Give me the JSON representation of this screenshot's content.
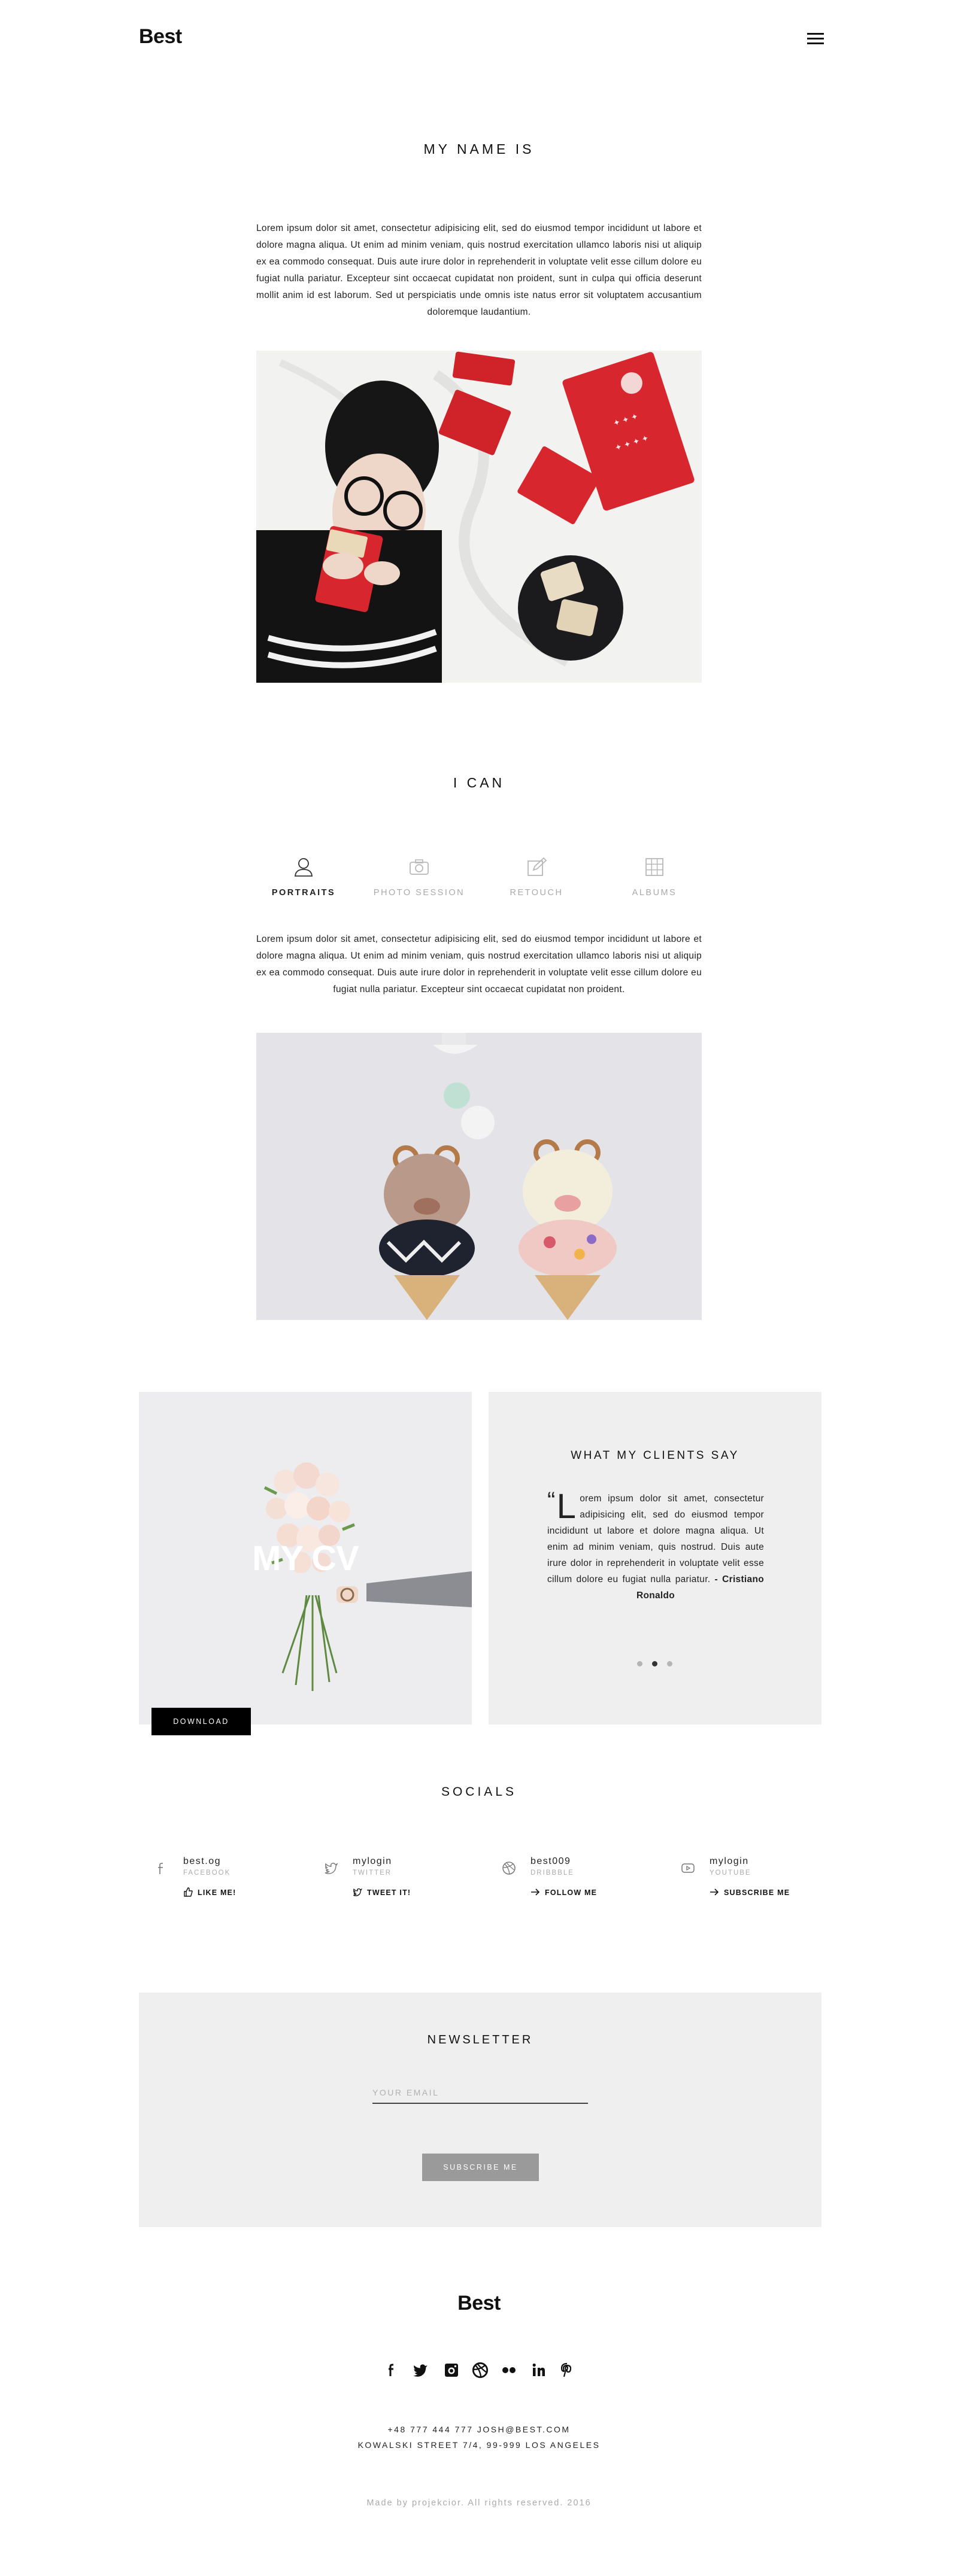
{
  "header": {
    "logo": "Best",
    "menu_icon": "hamburger-menu-icon"
  },
  "about": {
    "title": "MY NAME IS",
    "text": "Lorem ipsum dolor sit amet, consectetur adipisicing elit, sed do eiusmod tempor incididunt ut labore et dolore magna aliqua. Ut enim ad minim veniam, quis nostrud exercitation ullamco laboris nisi ut aliquip ex ea commodo consequat. Duis aute irure dolor in reprehenderit in voluptate velit esse cillum dolore eu fugiat nulla pariatur. Excepteur sint occaecat cupidatat non proident, sunt in culpa qui officia deserunt mollit anim id est laborum. Sed ut perspiciatis unde omnis iste natus error sit voluptatem accusantium doloremque laudantium."
  },
  "skills": {
    "title": "I CAN",
    "items": [
      {
        "label": "PORTRAITS",
        "icon": "user-icon",
        "active": true
      },
      {
        "label": "PHOTO SESSION",
        "icon": "camera-icon",
        "active": false
      },
      {
        "label": "RETOUCH",
        "icon": "edit-icon",
        "active": false
      },
      {
        "label": "ALBUMS",
        "icon": "grid-icon",
        "active": false
      }
    ],
    "text": "Lorem ipsum dolor sit amet, consectetur adipisicing elit, sed do eiusmod tempor incididunt ut labore et dolore magna aliqua. Ut enim ad minim veniam, quis nostrud exercitation ullamco laboris nisi ut aliquip ex ea commodo consequat. Duis aute irure dolor in reprehenderit in voluptate velit esse cillum dolore eu fugiat nulla pariatur. Excepteur sint occaecat cupidatat non proident."
  },
  "cv": {
    "title": "MY CV",
    "download_label": "DOWNLOAD"
  },
  "testimonials": {
    "title": "WHAT MY CLIENTS SAY",
    "quote_mark": "“",
    "first_letter": "L",
    "quote": "orem ipsum dolor sit amet, consectetur adipisicing elit, sed do eiusmod tempor incididunt ut labore et dolore magna aliqua. Ut enim ad minim veniam, quis nostrud. Duis aute irure dolor in reprehenderit in voluptate velit esse cillum dolore eu fugiat nulla pariatur.",
    "author": " - Cristiano Ronaldo",
    "active_dot": 1,
    "dot_count": 3
  },
  "socials": {
    "title": "SOCIALS",
    "items": [
      {
        "icon": "facebook-icon",
        "handle": "best.og",
        "network": "FACEBOOK",
        "action_icon": "thumbs-up-icon",
        "action": "LIKE ME!"
      },
      {
        "icon": "twitter-icon",
        "handle": "mylogin",
        "network": "TWITTER",
        "action_icon": "twitter-icon",
        "action": "TWEET IT!"
      },
      {
        "icon": "dribbble-icon",
        "handle": "best009",
        "network": "DRIBBBLE",
        "action_icon": "arrow-right-icon",
        "action": "FOLLOW ME"
      },
      {
        "icon": "youtube-icon",
        "handle": "mylogin",
        "network": "YOUTUBE",
        "action_icon": "arrow-right-icon",
        "action": "SUBSCRIBE ME"
      }
    ]
  },
  "newsletter": {
    "title": "NEWSLETTER",
    "email_placeholder": "YOUR EMAIL",
    "email_value": "",
    "button_label": "SUBSCRIBE ME"
  },
  "footer": {
    "logo": "Best",
    "social_icons": [
      "facebook-icon",
      "twitter-icon",
      "instagram-icon",
      "dribbble-icon",
      "flickr-icon",
      "linkedin-icon",
      "pinterest-icon"
    ],
    "contact_line1": "+48 777 444 777  JOSH@BEST.COM",
    "contact_line2": "KOWALSKI STREET 7/4, 99-999 LOS ANGELES",
    "copyright": "Made by projekcior. All rights reserved. 2016"
  },
  "colors": {
    "background": "#ffffff",
    "panel": "#efefef",
    "text": "#1a1a1a",
    "muted": "#aaaaaa",
    "button_dark": "#000000",
    "button_grey": "#9a9a9a",
    "accent_red": "#d8262e"
  }
}
